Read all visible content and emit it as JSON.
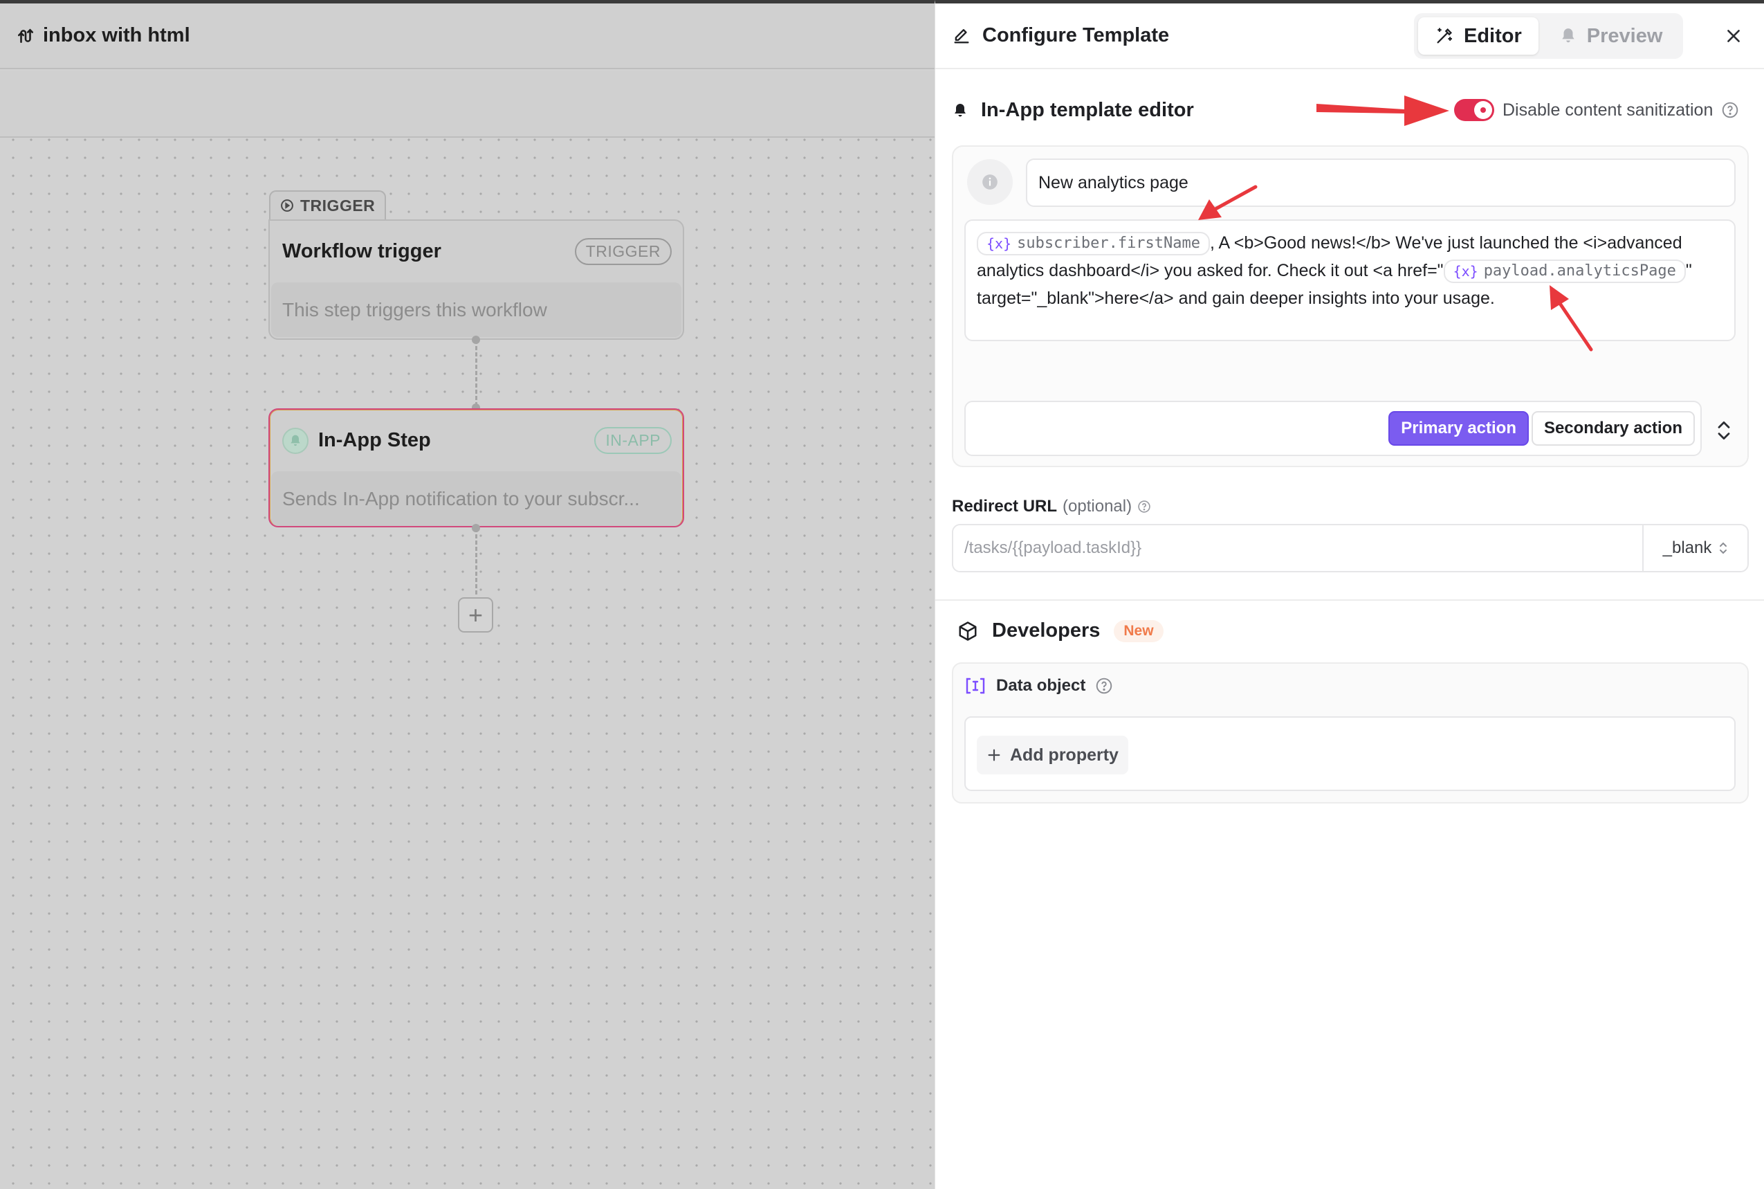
{
  "workflow": {
    "title": "inbox with html",
    "trigger_tab": "TRIGGER",
    "trigger_node": {
      "name": "Workflow trigger",
      "badge": "TRIGGER",
      "description": "This step triggers this workflow"
    },
    "inapp_node": {
      "name": "In-App Step",
      "badge": "IN-APP",
      "description": "Sends In-App notification to your subscr..."
    },
    "add_step_symbol": "+"
  },
  "panel": {
    "title": "Configure Template",
    "tabs": [
      {
        "label": "Editor",
        "icon": "magic-wand-icon"
      },
      {
        "label": "Preview",
        "icon": "bell-icon"
      }
    ],
    "editor_title": "In-App template editor",
    "sanitization_label": "Disable content sanitization",
    "sanitization_enabled": true,
    "subject_value": "New analytics page",
    "body": {
      "var1": "subscriber.firstName",
      "text1": ", A <b>Good news!</b> We've just launched the <i>advanced analytics dashboard</i> you asked for. Check it out <a href=\"",
      "var2": "payload.analyticsPage",
      "text2": "\" target=\"_blank\">here</a> and gain deeper insights into your usage."
    },
    "primary_action": "Primary action",
    "secondary_action": "Secondary action",
    "redirect": {
      "label": "Redirect URL",
      "optional": "(optional)",
      "value": "/tasks/{{payload.taskId}}",
      "target": "_blank"
    },
    "developers": {
      "title": "Developers",
      "badge": "New",
      "data_object_label": "Data object",
      "add_property_label": "Add property"
    }
  },
  "colors": {
    "accent": "#7b5cf0",
    "toggle": "#e12e51",
    "annotation": "#e8383d"
  }
}
